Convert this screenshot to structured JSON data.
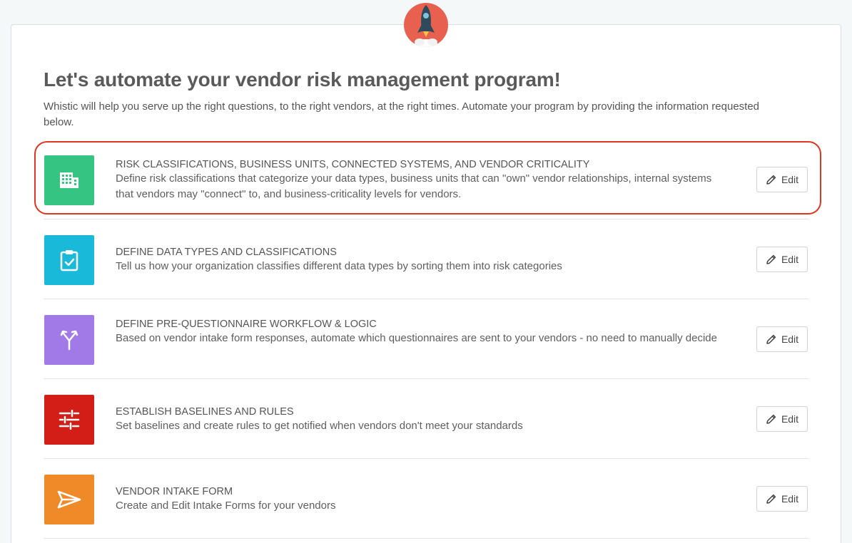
{
  "page": {
    "title": "Let's automate your vendor risk management program!",
    "intro": "Whistic will help you serve up the right questions, to the right vendors, at the right times. Automate your program by providing the information requested below."
  },
  "header_icon": "rocket-icon",
  "colors": {
    "green": "#35c481",
    "cyan": "#19b9d9",
    "purple": "#a27ae8",
    "red": "#d21e16",
    "orange": "#ef8a29",
    "highlight": "#e0351e",
    "rocket_bg": "#e8614f"
  },
  "steps": [
    {
      "icon": "building-icon",
      "title": "RISK CLASSIFICATIONS, BUSINESS UNITS, CONNECTED SYSTEMS, AND VENDOR CRITICALITY",
      "description": "Define risk classifications that categorize your data types, business units that can \"own\" vendor relationships, internal systems that vendors may \"connect\" to, and business-criticality levels for vendors.",
      "edit_label": "Edit"
    },
    {
      "icon": "clipboard-check-icon",
      "title": "DEFINE DATA TYPES AND CLASSIFICATIONS",
      "description": "Tell us how your organization classifies different data types by sorting them into risk categories",
      "edit_label": "Edit"
    },
    {
      "icon": "merge-arrows-icon",
      "title": "DEFINE PRE-QUESTIONNAIRE WORKFLOW & LOGIC",
      "description": "Based on vendor intake form responses, automate which questionnaires are sent to your vendors - no need to manually decide",
      "edit_label": "Edit"
    },
    {
      "icon": "sliders-icon",
      "title": "ESTABLISH BASELINES AND RULES",
      "description": "Set baselines and create rules to get notified when vendors don't meet your standards",
      "edit_label": "Edit"
    },
    {
      "icon": "send-icon",
      "title": "VENDOR INTAKE FORM",
      "description": "Create and Edit Intake Forms for your vendors",
      "edit_label": "Edit"
    }
  ]
}
